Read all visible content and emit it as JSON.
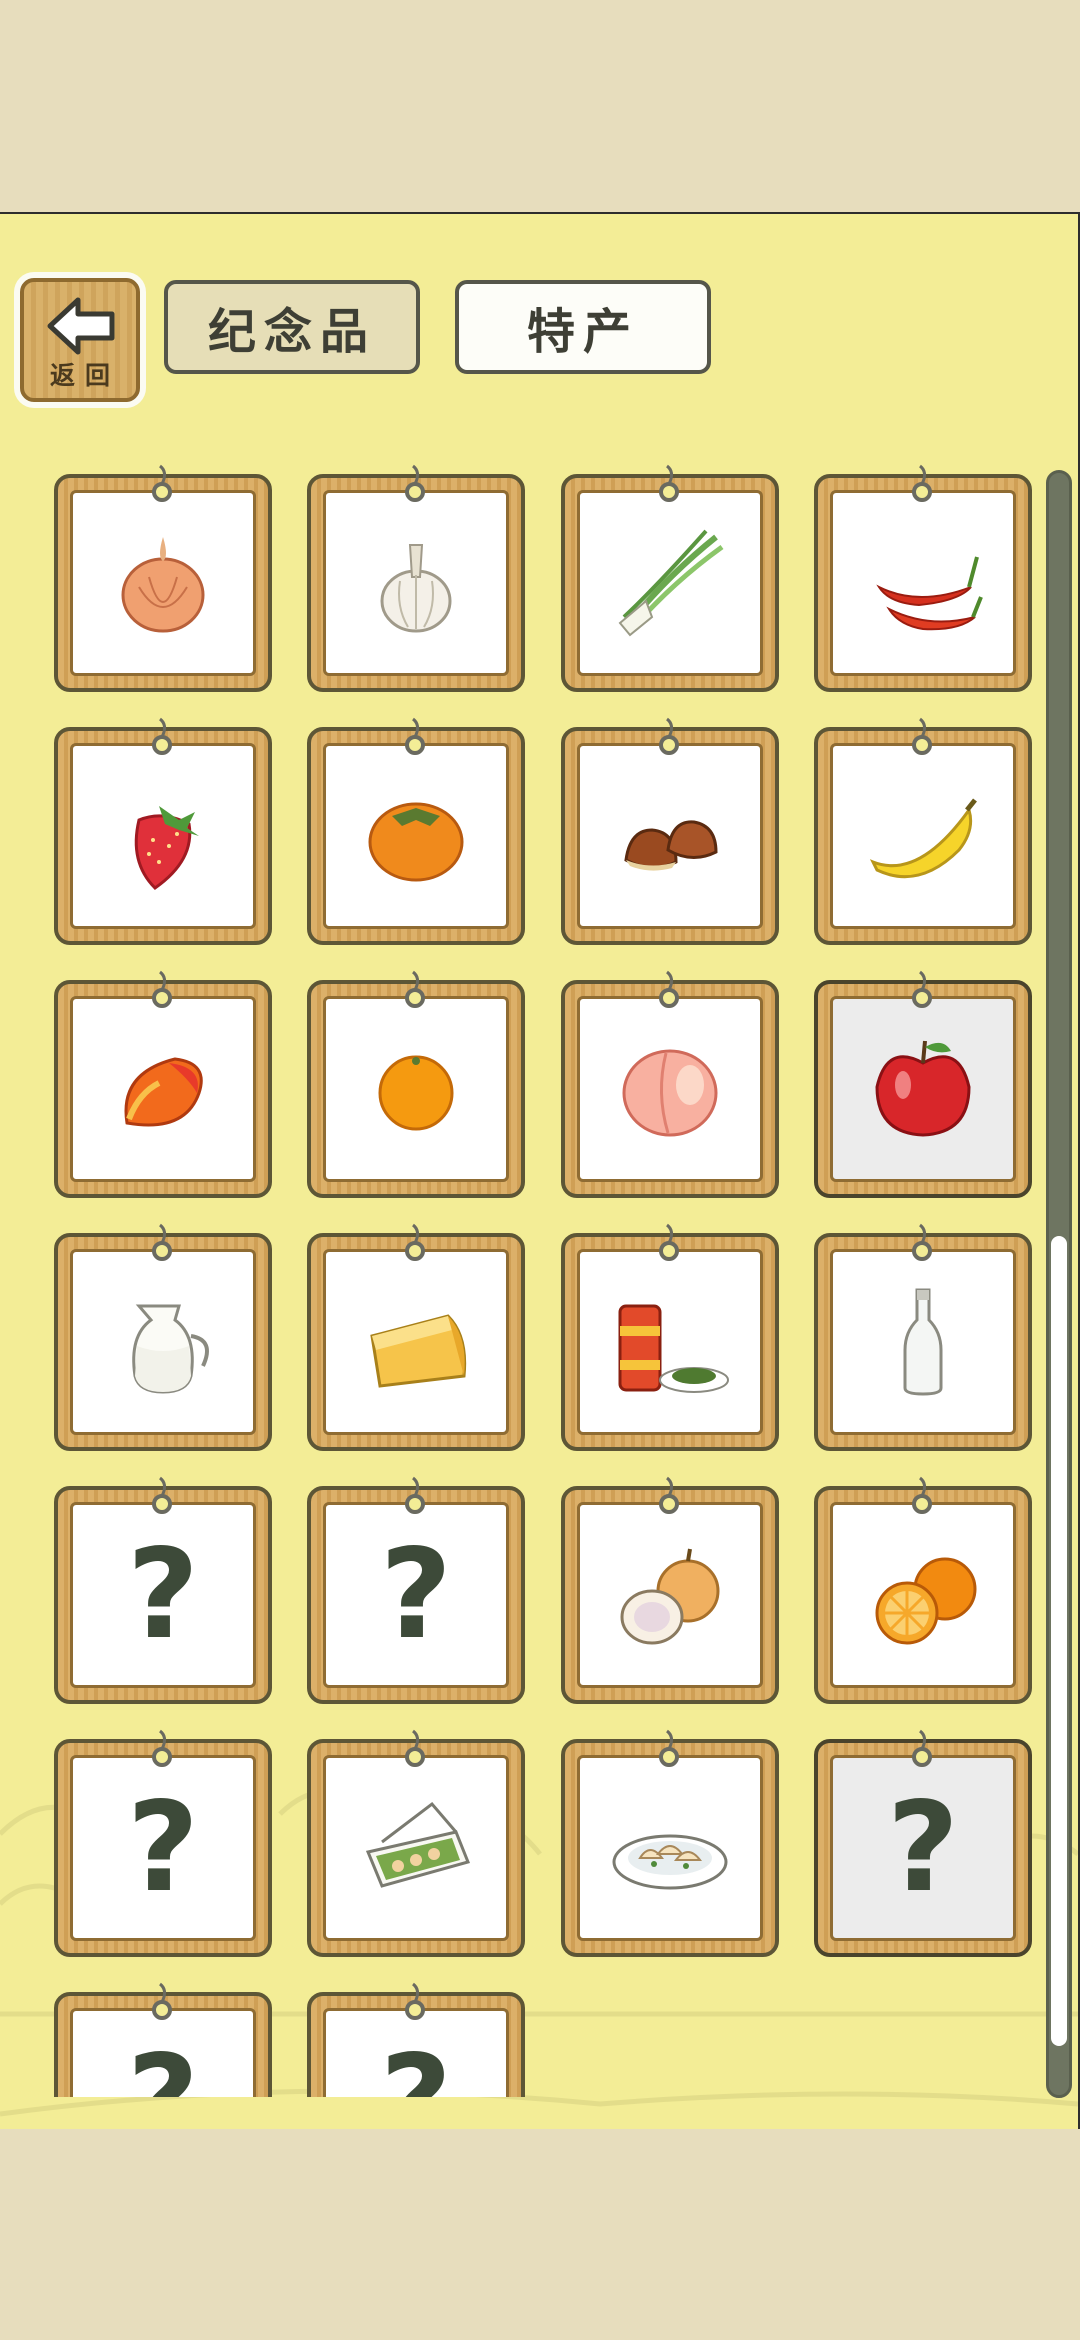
{
  "header": {
    "back_label": "返回",
    "tabs": [
      {
        "label": "纪念品",
        "active": false
      },
      {
        "label": "特产",
        "active": true
      }
    ]
  },
  "items": [
    {
      "icon": "onion-icon",
      "unknown": false
    },
    {
      "icon": "garlic-icon",
      "unknown": false
    },
    {
      "icon": "green-onion-icon",
      "unknown": false
    },
    {
      "icon": "chili-pepper-icon",
      "unknown": false
    },
    {
      "icon": "strawberry-icon",
      "unknown": false
    },
    {
      "icon": "persimmon-icon",
      "unknown": false
    },
    {
      "icon": "chestnut-icon",
      "unknown": false
    },
    {
      "icon": "banana-icon",
      "unknown": false
    },
    {
      "icon": "mango-icon",
      "unknown": false
    },
    {
      "icon": "mandarin-icon",
      "unknown": false
    },
    {
      "icon": "peach-icon",
      "unknown": false
    },
    {
      "icon": "apple-icon",
      "unknown": false,
      "selected": true
    },
    {
      "icon": "milk-jug-icon",
      "unknown": false
    },
    {
      "icon": "cheese-icon",
      "unknown": false
    },
    {
      "icon": "tea-canister-icon",
      "unknown": false
    },
    {
      "icon": "bottle-icon",
      "unknown": false
    },
    {
      "icon": "question-icon",
      "unknown": true,
      "label": "?"
    },
    {
      "icon": "question-icon",
      "unknown": true,
      "label": "?"
    },
    {
      "icon": "coconut-icon",
      "unknown": false
    },
    {
      "icon": "orange-icon",
      "unknown": false
    },
    {
      "icon": "question-icon",
      "unknown": true,
      "label": "?"
    },
    {
      "icon": "bento-box-icon",
      "unknown": false
    },
    {
      "icon": "dumpling-plate-icon",
      "unknown": false
    },
    {
      "icon": "question-icon",
      "unknown": true,
      "label": "?",
      "selected": true
    },
    {
      "icon": "question-icon",
      "unknown": true,
      "label": "?"
    },
    {
      "icon": "question-icon",
      "unknown": true,
      "label": "?"
    }
  ],
  "colors": {
    "page_bg": "#e7ddbd",
    "panel_bg": "#f3ed96",
    "frame_wood": "#dcb069",
    "frame_border": "#5d5636",
    "question_mark": "#3d4a39"
  },
  "scroll": {
    "position": 0.62
  }
}
